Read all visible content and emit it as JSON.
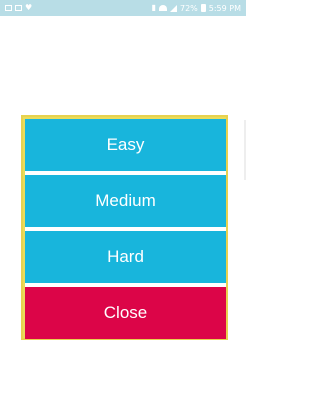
{
  "status_bar": {
    "time": "5:59 PM",
    "battery_level": "72%",
    "left_icons": [
      "sim-icon",
      "photo-icon",
      "heart-icon"
    ],
    "right_icons": [
      "vibrate-icon",
      "wifi-icon",
      "signal-icon",
      "battery-icon"
    ]
  },
  "dialog": {
    "buttons": [
      {
        "label": "Easy",
        "color": "#18b5dc"
      },
      {
        "label": "Medium",
        "color": "#18b5dc"
      },
      {
        "label": "Hard",
        "color": "#18b5dc"
      },
      {
        "label": "Close",
        "color": "#dc0548"
      }
    ],
    "frame_color": "#e7d24f"
  }
}
